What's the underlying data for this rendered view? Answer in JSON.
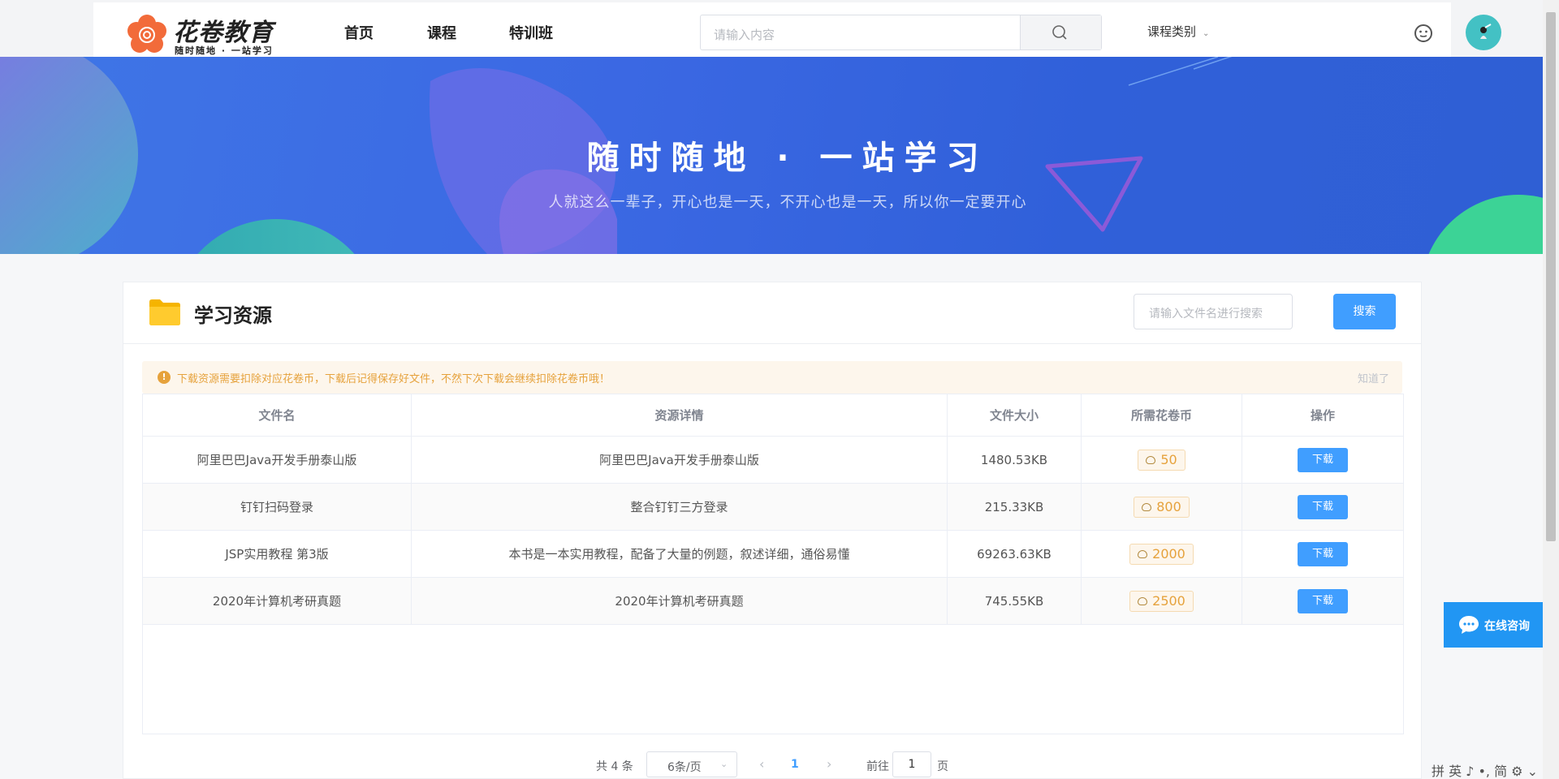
{
  "header": {
    "brand": "花卷教育",
    "slogan": "随时随地 · 一站学习",
    "nav": [
      "首页",
      "课程",
      "特训班"
    ],
    "search_placeholder": "请输入内容",
    "category_label": "课程类别",
    "icons": {
      "search": "search-icon",
      "message": "smiley-message-icon",
      "avatar": "user-avatar"
    }
  },
  "banner": {
    "title": "随时随地 · 一站学习",
    "subtitle": "人就这么一辈子，开心也是一天，不开心也是一天，所以你一定要开心"
  },
  "resources": {
    "title": "学习资源",
    "search_placeholder": "请输入文件名进行搜索",
    "search_button": "搜索",
    "alert": {
      "text": "下载资源需要扣除对应花卷币，下载后记得保存好文件，不然下次下载会继续扣除花卷币哦！",
      "close": "知道了"
    },
    "columns": [
      "文件名",
      "资源详情",
      "文件大小",
      "所需花卷币",
      "操作"
    ],
    "rows": [
      {
        "name": "阿里巴巴Java开发手册泰山版",
        "detail": "阿里巴巴Java开发手册泰山版",
        "size": "1480.53KB",
        "coins": "50",
        "action": "下载"
      },
      {
        "name": "钉钉扫码登录",
        "detail": "整合钉钉三方登录",
        "size": "215.33KB",
        "coins": "800",
        "action": "下载"
      },
      {
        "name": "JSP实用教程 第3版",
        "detail": "本书是一本实用教程，配备了大量的例题，叙述详细，通俗易懂",
        "size": "69263.63KB",
        "coins": "2000",
        "action": "下载"
      },
      {
        "name": "2020年计算机考研真题",
        "detail": "2020年计算机考研真题",
        "size": "745.55KB",
        "coins": "2500",
        "action": "下载"
      }
    ],
    "pagination": {
      "total": "共 4 条",
      "page_size": "6条/页",
      "current_page": "1",
      "goto_label": "前往",
      "goto_value": "1",
      "page_suffix": "页"
    }
  },
  "consult": {
    "label": "在线咨询"
  },
  "tray": {
    "text": "拼 英 ♪ •, 简 ⚙ ⌄"
  },
  "colors": {
    "primary": "#409eff",
    "warning": "#e6a23c",
    "banner": "#3b68e3",
    "consult": "#2196f3"
  }
}
